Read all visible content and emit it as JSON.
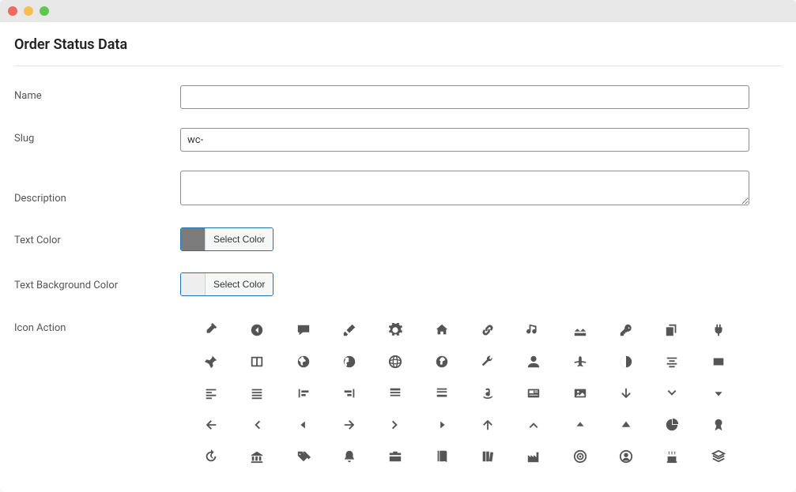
{
  "page_title": "Order Status Data",
  "fields": {
    "name": {
      "label": "Name",
      "value": ""
    },
    "slug": {
      "label": "Slug",
      "value": "wc-"
    },
    "description": {
      "label": "Description",
      "value": ""
    },
    "text_color": {
      "label": "Text Color",
      "button": "Select Color",
      "swatch": "#7b7b7b"
    },
    "bg_color": {
      "label": "Text Background Color",
      "button": "Select Color",
      "swatch": "#eeeeee"
    },
    "icon_action": {
      "label": "Icon Action"
    }
  },
  "icons": [
    [
      "eyedropper",
      "caret-left-circle",
      "comment",
      "brush",
      "gear",
      "home",
      "link",
      "music-share",
      "rooftops",
      "key",
      "copy",
      "plug"
    ],
    [
      "pushpin",
      "split-panel",
      "globe-africa",
      "globe-americas",
      "globe-grid",
      "globe-asia",
      "wrench",
      "user",
      "airplane",
      "contrast",
      "align-center",
      "square"
    ],
    [
      "align-left",
      "align-justify",
      "align-start",
      "align-end",
      "list-top",
      "list-bottom",
      "amazon",
      "news",
      "image",
      "arrow-down",
      "chevron-down",
      "triangle-down"
    ],
    [
      "arrow-left",
      "chevron-left",
      "triangle-left",
      "arrow-right",
      "chevron-right",
      "triangle-right",
      "arrow-up",
      "chevron-up",
      "triangle-up",
      "triangle-up-solid",
      "pie-chart",
      "award"
    ],
    [
      "history",
      "bank",
      "tags",
      "bell",
      "briefcase",
      "book",
      "books",
      "factory",
      "target",
      "user-circle",
      "birthday-cake",
      "layers"
    ]
  ]
}
